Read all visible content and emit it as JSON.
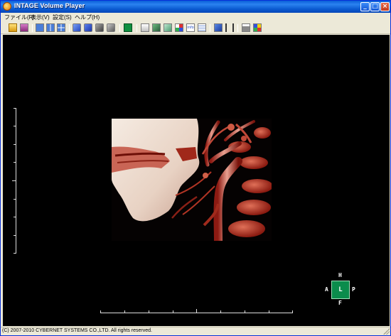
{
  "window": {
    "title": "INTAGE Volume Player"
  },
  "window_buttons": {
    "minimize": "_",
    "maximize": "□",
    "close": "×"
  },
  "menu": {
    "items": [
      "ファイル(F)",
      "表示(V)",
      "設定(S)",
      "ヘルプ(H)"
    ]
  },
  "toolbar": {
    "icons": [
      "open-folder-icon",
      "open-volume-icon",
      "single-view-icon",
      "dual-view-icon",
      "quad-view-icon",
      "shaded-cube-blue-icon",
      "shaded-cube-blue2-icon",
      "shaded-cube-gray-icon",
      "shaded-cube-gray2-icon",
      "green-square-icon",
      "layout-icon",
      "crop-box-icon",
      "clip-box-icon",
      "axes-icon",
      "info-icon",
      "document-icon",
      "volume-box-icon",
      "tower-icon",
      "gallery-icon",
      "color-map-icon"
    ],
    "colors": {
      "blue": "#3a5fd8",
      "gray": "#707070",
      "green": "#109040"
    }
  },
  "orientation": {
    "top": "H",
    "left": "A",
    "center": "L",
    "right": "P",
    "bottom": "F",
    "box_color": "#0b8c4c"
  },
  "status": {
    "text": "(C) 2007-2010 CYBERNET SYSTEMS CO.,LTD. All rights reserved."
  }
}
